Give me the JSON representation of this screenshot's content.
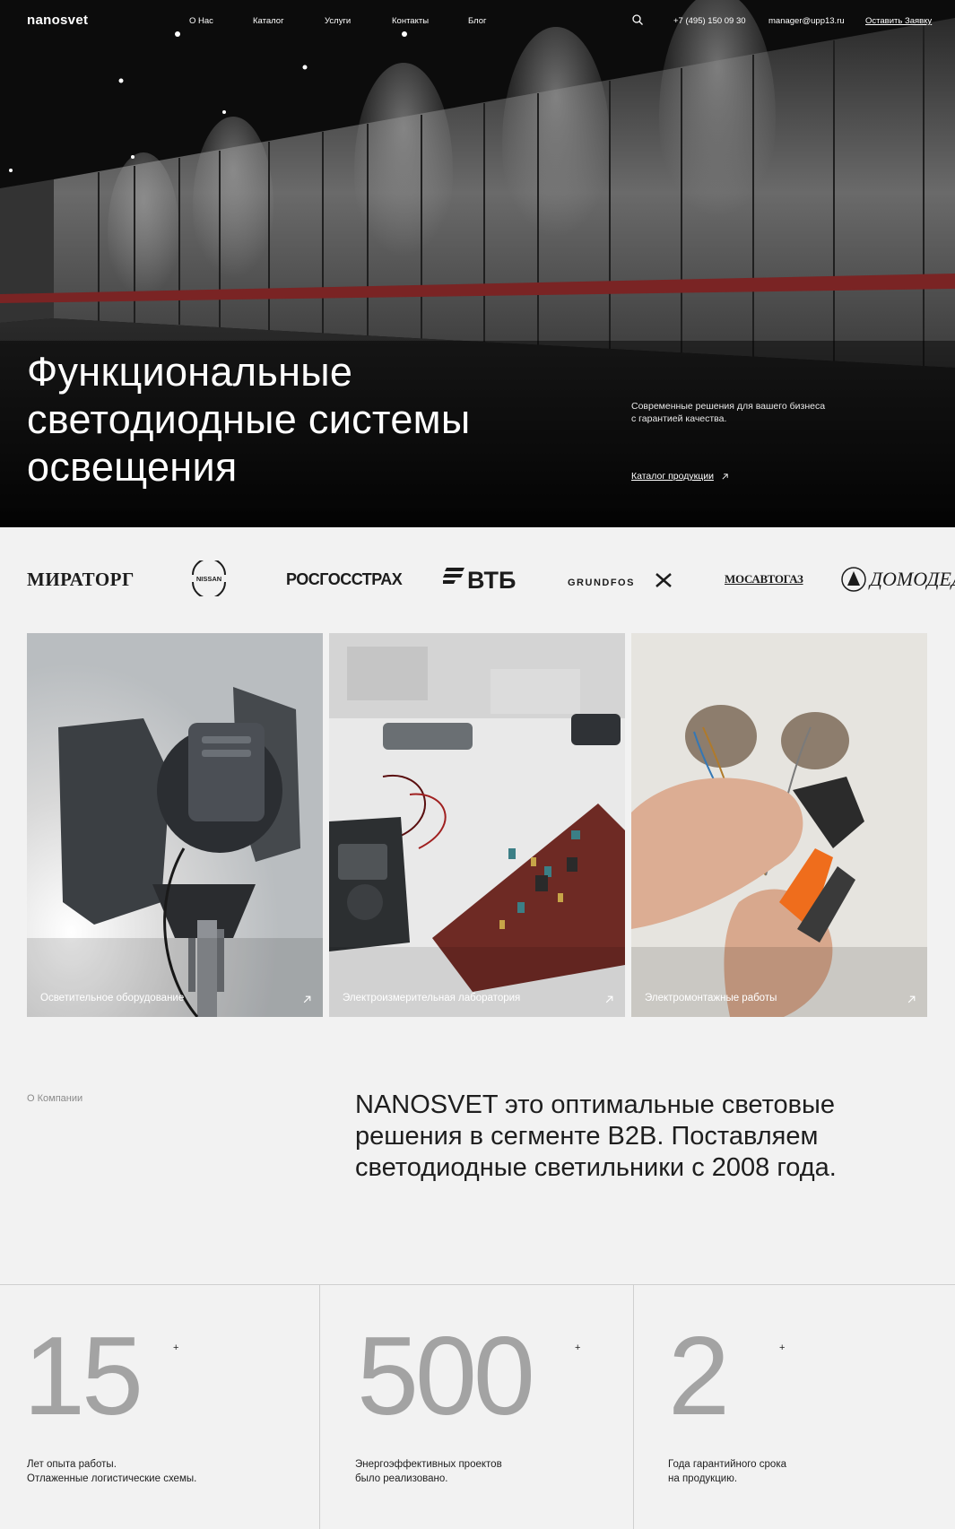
{
  "header": {
    "logo": "nanosvet",
    "nav": [
      "О Нас",
      "Каталог",
      "Услуги",
      "Контакты",
      "Блог"
    ],
    "search_icon": "search-icon",
    "phone": "+7 (495) 150 09 30",
    "email": "manager@upp13.ru",
    "cta": "Оставить Заявку"
  },
  "hero": {
    "title_lines": [
      "Функциональные",
      "светодиодные системы",
      "освещения"
    ],
    "subtitle_lines": [
      "Современные решения для вашего бизнеса",
      "с гарантией качества."
    ],
    "catalog_link": "Каталог продукции"
  },
  "partners": [
    "МИРАТОРГ",
    "NISSAN",
    "РОСГОССТРАХ",
    "ВТБ",
    "GRUNDFOS",
    "МОСАВТОГАЗ",
    "ДОМОДЕДОВО"
  ],
  "services": [
    {
      "label": "Осветительное оборудование"
    },
    {
      "label": "Электроизмерительная лаборатория"
    },
    {
      "label": "Электромонтажные работы"
    }
  ],
  "about": {
    "label": "О Компании",
    "text": "NANOSVET это оптимальные световые решения в сегменте B2B. Поставляем светодиодные светильники с 2008 года."
  },
  "stats": [
    {
      "value": "15",
      "plus": "+",
      "desc_lines": [
        "Лет опыта работы.",
        "Отлаженные логистические схемы."
      ]
    },
    {
      "value": "500",
      "plus": "+",
      "desc_lines": [
        "Энергоэффективных проектов",
        "было реализовано."
      ]
    },
    {
      "value": "2",
      "plus": "+",
      "desc_lines": [
        "Года гарантийного срока",
        "на продукцию."
      ]
    }
  ],
  "colors": {
    "hero_bg": "#141414",
    "page_bg": "#f2f2f2",
    "accent_red": "#7a2424",
    "stat_number": "#a3a3a3"
  }
}
